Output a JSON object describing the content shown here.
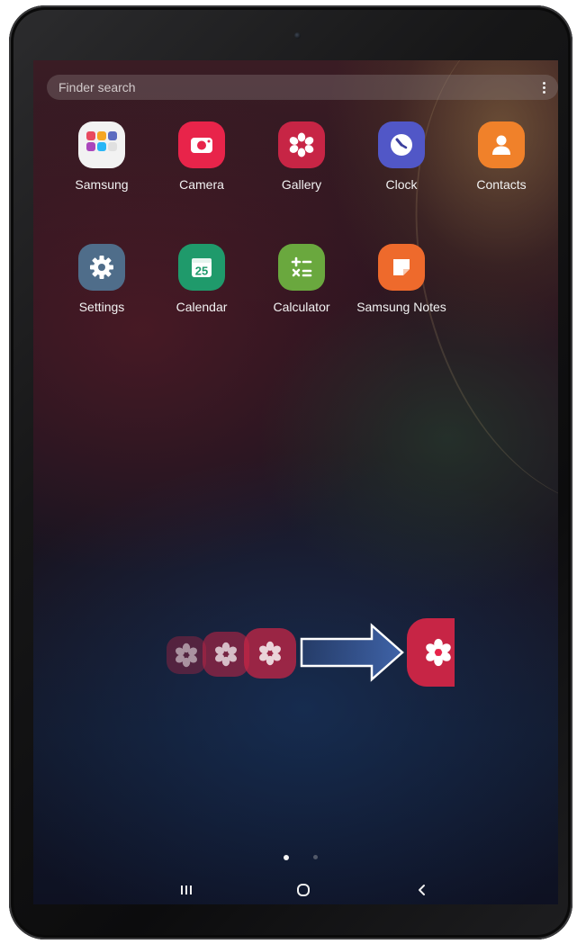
{
  "search": {
    "placeholder": "Finder search",
    "menu_icon": "more-vert-icon"
  },
  "apps": [
    {
      "label": "Samsung",
      "icon": "samsung-folder-icon",
      "color": "#f2f2f2"
    },
    {
      "label": "Camera",
      "icon": "camera-icon",
      "color": "#e8244a"
    },
    {
      "label": "Gallery",
      "icon": "gallery-flower-icon",
      "color": "#c72545"
    },
    {
      "label": "Clock",
      "icon": "clock-icon",
      "color": "#5157c7"
    },
    {
      "label": "Contacts",
      "icon": "contacts-icon",
      "color": "#f0812a"
    },
    {
      "label": "Settings",
      "icon": "gear-icon",
      "color": "#4f6d8a"
    },
    {
      "label": "Calendar",
      "icon": "calendar-icon",
      "color": "#1f9a6b",
      "day": "25"
    },
    {
      "label": "Calculator",
      "icon": "calculator-icon",
      "color": "#6aa83e",
      "glyphs": "+−\n×="
    },
    {
      "label": "Samsung Notes",
      "icon": "notes-icon",
      "color": "#ee6a2c"
    }
  ],
  "overlay": {
    "description_icon": "drag-app-arrow-icon",
    "gallery_color": "#c72545",
    "arrow_color": "#3f63a8"
  },
  "page_indicator": {
    "current": 1,
    "total": 2
  },
  "navbar": {
    "recents_icon": "recents-icon",
    "home_icon": "home-icon",
    "back_icon": "back-icon"
  }
}
